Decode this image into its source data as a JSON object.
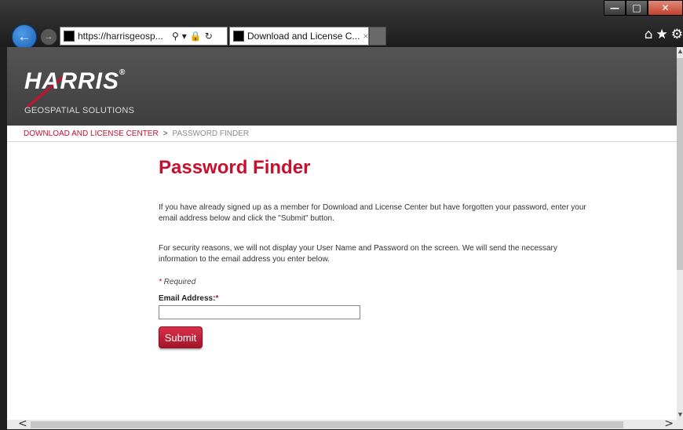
{
  "browser": {
    "url_scheme": "https://",
    "url_rest": "harrisgeosp...",
    "tab_title": "Download and License C...",
    "tab_close": "×",
    "win_min": "—",
    "win_max": "□",
    "win_close": "✕",
    "back_icon": "←",
    "forward_icon": "→",
    "search_icon": "⚲",
    "dropdown_icon": "▾",
    "lock_icon": "🔒",
    "refresh_icon": "↻",
    "home_icon": "⌂",
    "favorites_icon": "★",
    "settings_icon": "⚙"
  },
  "site": {
    "logo_text": "HARRIS",
    "logo_reg": "®",
    "logo_tagline": "GEOSPATIAL SOLUTIONS"
  },
  "breadcrumb": {
    "link": "DOWNLOAD AND LICENSE CENTER",
    "separator": ">",
    "current": "PASSWORD FINDER"
  },
  "form": {
    "title": "Password Finder",
    "para1": "If you have already signed up as a member for Download and License Center but have forgotten your password, enter your email address below and click the \"Submit\" button.",
    "para2": "For security reasons, we will not display your User Name and Password on the screen. We will send the necessary information to the email address you enter below.",
    "required_star": "*",
    "required_text": " Required",
    "email_label": "Email Address:",
    "email_value": "",
    "submit_label": "Submit"
  },
  "scroll": {
    "up": "▲",
    "down": "▼",
    "left": "<",
    "right": ">"
  },
  "colors": {
    "brand_red": "#c8102e",
    "header_gray": "#4a4a4a"
  }
}
